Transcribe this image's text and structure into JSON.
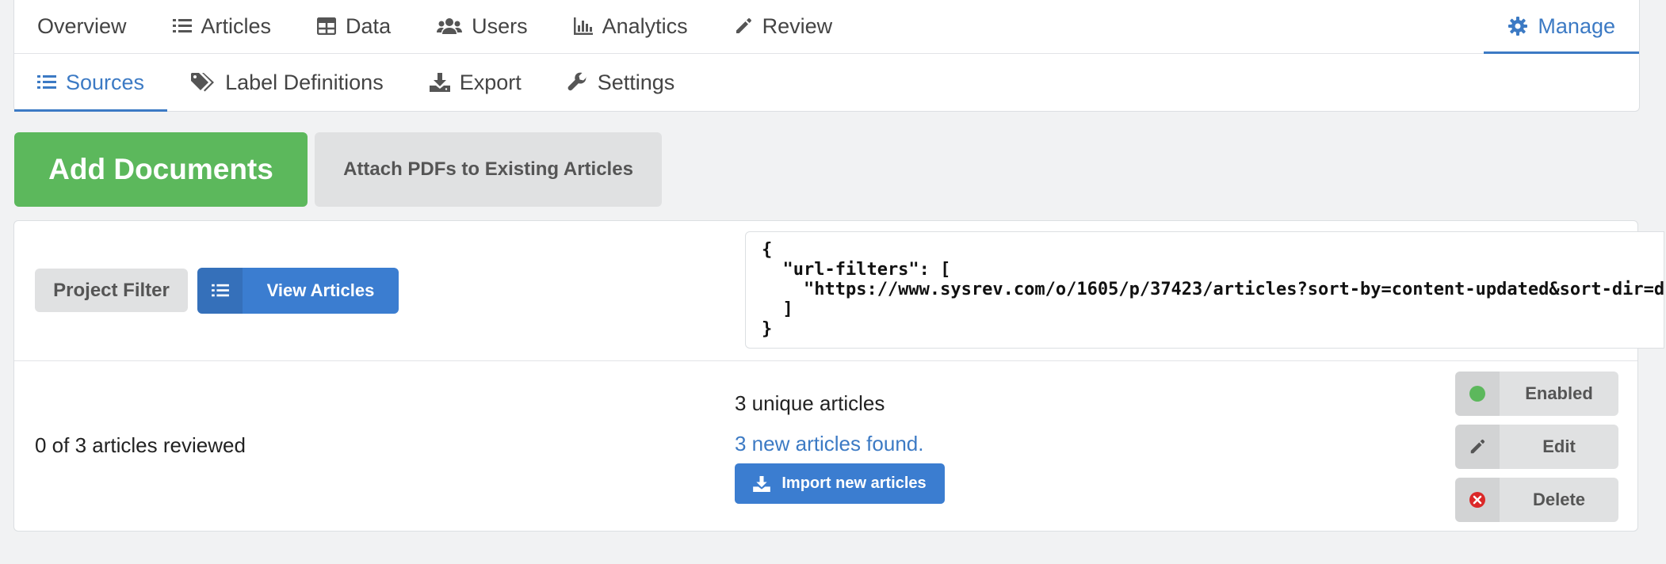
{
  "nav": {
    "tabs": [
      {
        "label": "Overview",
        "icon": "none"
      },
      {
        "label": "Articles",
        "icon": "list-icon"
      },
      {
        "label": "Data",
        "icon": "table-icon"
      },
      {
        "label": "Users",
        "icon": "users-icon"
      },
      {
        "label": "Analytics",
        "icon": "bar-chart-icon"
      },
      {
        "label": "Review",
        "icon": "pencil-icon"
      }
    ],
    "manage": {
      "label": "Manage",
      "icon": "gear-icon"
    }
  },
  "subnav": {
    "tabs": [
      {
        "label": "Sources",
        "icon": "list-icon",
        "active": true
      },
      {
        "label": "Label Definitions",
        "icon": "tags-icon"
      },
      {
        "label": "Export",
        "icon": "download-icon"
      },
      {
        "label": "Settings",
        "icon": "wrench-icon"
      }
    ]
  },
  "actions": {
    "add_documents": "Add Documents",
    "attach_pdfs": "Attach PDFs to Existing Articles"
  },
  "source": {
    "type_label": "Project Filter",
    "view_articles": "View Articles",
    "filter_json": "{\n  \"url-filters\": [\n    \"https://www.sysrev.com/o/1605/p/37423/articles?sort-by=content-updated&sort-dir=desc\"\n  ]\n}",
    "reviewed": "0 of 3 articles reviewed",
    "unique": "3 unique articles",
    "new_found": "3 new articles found.",
    "import_label": "Import new articles",
    "enabled_label": "Enabled",
    "edit_label": "Edit",
    "delete_label": "Delete"
  },
  "colors": {
    "accent": "#3c7ac4",
    "primary_button": "#3b7dd0",
    "success": "#5cb85c",
    "danger": "#db2828"
  }
}
